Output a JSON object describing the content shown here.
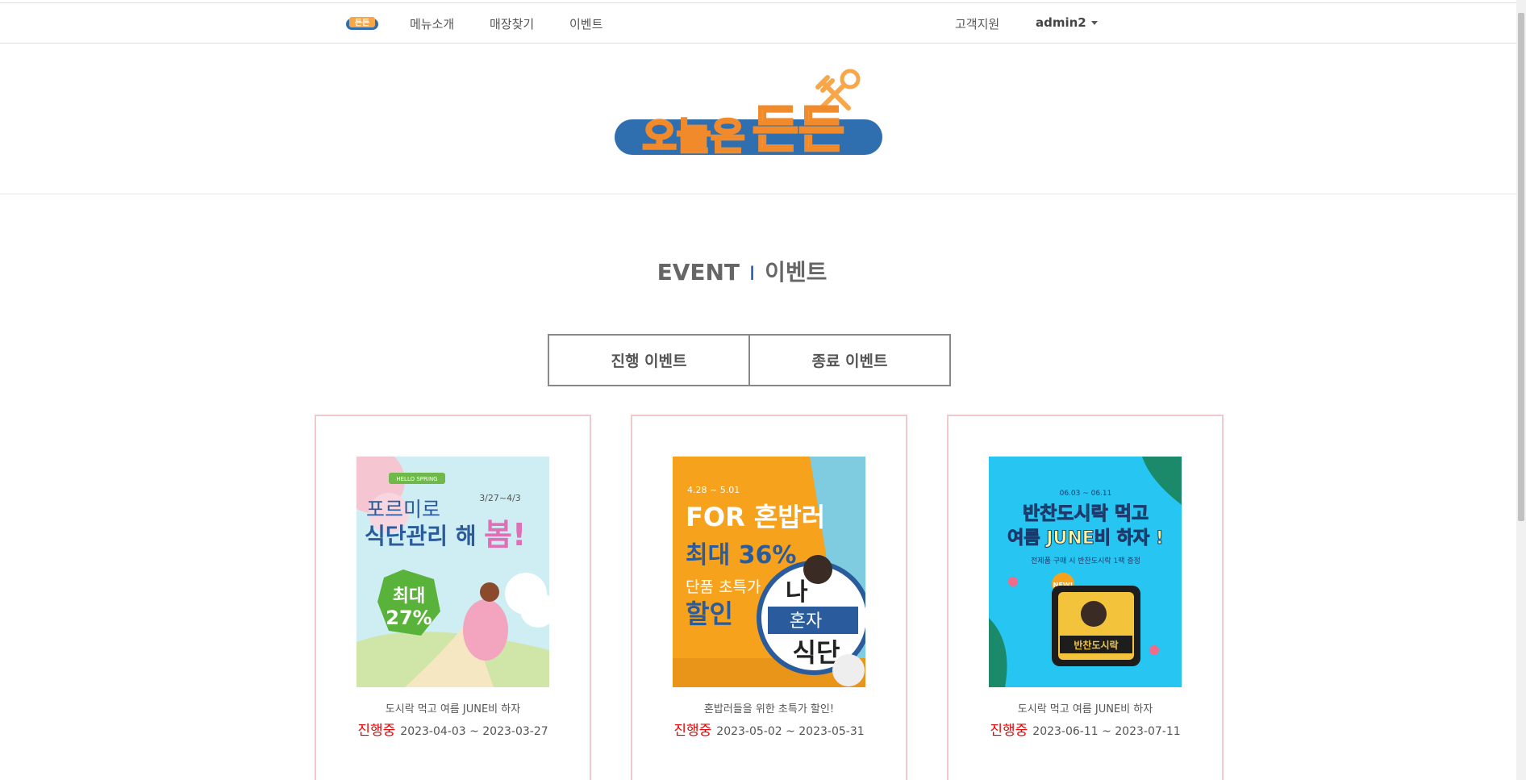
{
  "nav": {
    "logo_text": "든든",
    "menu_label": "메뉴소개",
    "store_label": "매장찾기",
    "event_label": "이벤트",
    "support_label": "고객지원",
    "admin_label": "admin2"
  },
  "header": {
    "logo_text_left": "오늘은",
    "logo_text_right": "든든"
  },
  "title": {
    "en": "EVENT",
    "separator": "I",
    "ko": "이벤트"
  },
  "tabs": [
    {
      "label": "진행 이벤트"
    },
    {
      "label": "종료 이벤트"
    }
  ],
  "events": [
    {
      "image_lines": [
        "HELLO SPRING",
        "3/27~4/3",
        "포르미로",
        "식단관리 해",
        "봄!",
        "최대",
        "27%"
      ],
      "description": "도시락 먹고 여름 JUNE비 하자",
      "status": "진행중",
      "dates": "2023-04-03 ~ 2023-03-27"
    },
    {
      "image_lines": [
        "4.28 ~ 5.01",
        "FOR 혼밥러",
        "최대 36%",
        "단품 초특가",
        "할인",
        "나",
        "혼자",
        "식단"
      ],
      "description": "혼밥러들을 위한 초특가 할인!",
      "status": "진행중",
      "dates": "2023-05-02 ~ 2023-05-31"
    },
    {
      "image_lines": [
        "06.03 ~ 06.11",
        "반찬도시락 먹고",
        "여름 JUNE비 하자 !",
        "전제품 구매 시 반찬도시락 1팩 증정",
        "NEW!",
        "반찬도시락"
      ],
      "description": "도시락 먹고 여름 JUNE비 하자",
      "status": "진행중",
      "dates": "2023-06-11 ~ 2023-07-11"
    }
  ],
  "colors": {
    "accent_blue": "#1b4ea0",
    "status_red": "#e00000",
    "card_border": "#f0c9cf",
    "logo_orange": "#f7a64a",
    "logo_blue": "#2f6fb0"
  }
}
